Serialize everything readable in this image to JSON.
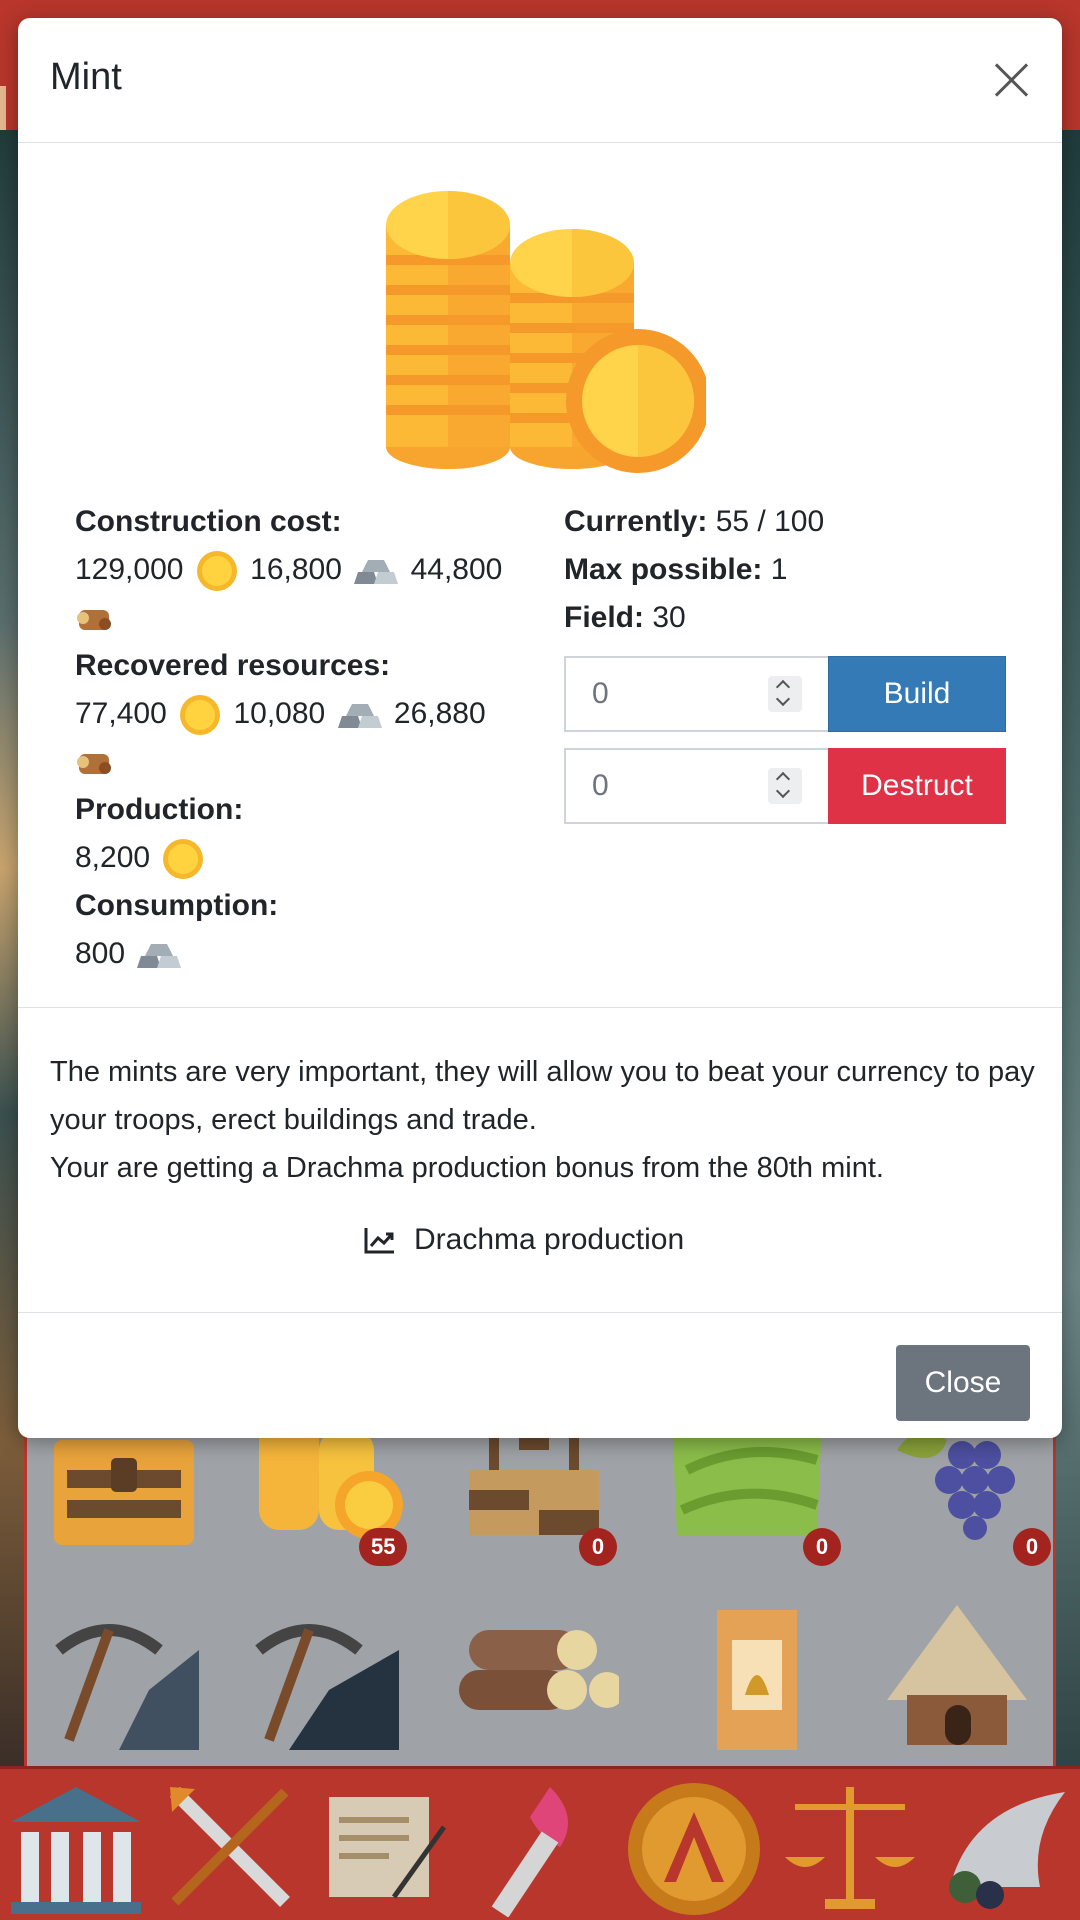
{
  "modal": {
    "title": "Mint",
    "construction_cost_label": "Construction cost:",
    "construction_cost": {
      "drachma": "129,000",
      "iron": "16,800",
      "wood": "44,800"
    },
    "recovered_label": "Recovered resources:",
    "recovered": {
      "drachma": "77,400",
      "iron": "10,080",
      "wood": "26,880"
    },
    "production_label": "Production:",
    "production": {
      "drachma": "8,200"
    },
    "consumption_label": "Consumption:",
    "consumption": {
      "iron": "800"
    },
    "currently_label": "Currently:",
    "currently_value": "55 / 100",
    "max_possible_label": "Max possible:",
    "max_possible_value": "1",
    "field_label": "Field:",
    "field_value": "30",
    "build_input_value": "0",
    "destruct_input_value": "0",
    "build_label": "Build",
    "destruct_label": "Destruct",
    "description_line1": "The mints are very important, they will allow you to beat your currency to pay your troops, erect buildings and trade.",
    "description_line2": "Your are getting a Drachma production bonus from the 80th mint.",
    "production_link_label": "Drachma production",
    "close_label": "Close",
    "icons": {
      "close": "close-icon",
      "drachma": "drachma-coin-icon",
      "iron": "iron-ingot-icon",
      "wood": "wood-log-icon",
      "chart": "line-chart-icon"
    }
  },
  "background": {
    "building_badges": [
      "55",
      "0",
      "0",
      "0"
    ],
    "building_icons": [
      "treasure-chest-icon",
      "mint-coins-icon",
      "well-icon",
      "field-icon",
      "vineyard-icon",
      "pickaxe-stone-icon",
      "pickaxe-coal-icon",
      "logs-icon",
      "bell-tower-icon",
      "hut-icon"
    ],
    "nav_icons": [
      "temple-icon",
      "crossed-swords-icon",
      "scroll-icon",
      "torch-icon",
      "spartan-shield-icon",
      "scales-icon",
      "cornucopia-icon"
    ]
  },
  "colors": {
    "build": "#337ab7",
    "destruct": "#e03246",
    "close": "#6c757d",
    "frame": "#b8362c",
    "badge": "#a3231f"
  }
}
